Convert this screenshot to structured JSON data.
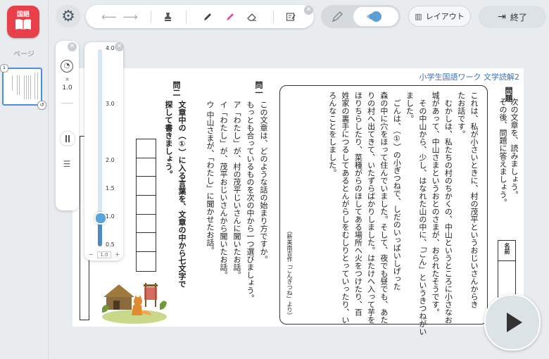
{
  "app": {
    "icon_label": "国語",
    "pages_label": "ページ",
    "thumbnail_number": "1"
  },
  "toolbar": {
    "back_icon": "arrow-left-icon",
    "forward_icon": "arrow-right-icon",
    "tools": [
      "stamp-icon",
      "pen-icon",
      "highlighter-icon",
      "eraser-icon",
      "edit-note-icon"
    ],
    "mode": [
      "pen-mode-icon",
      "touch-mode-icon"
    ],
    "layout_label": "レイアウト",
    "end_label": "終了"
  },
  "side_panel": {
    "speed_prefix": "×",
    "speed_value": "1.0"
  },
  "slider": {
    "ticks": [
      "4.0",
      "3.0",
      "2.0",
      "1.5",
      "1.0",
      "0.5"
    ],
    "value": "1.0",
    "minus": "−",
    "plus": "+"
  },
  "document": {
    "series_title": "小学生国語ワーク 文学読解2",
    "question_heading": "問題",
    "instruction": "次の文章を、読みましょう。\nその後、問題に答えましょう。",
    "name_label": "名前",
    "story": "これは、私が小さいときに、村の茂平というおじいさんからき\nたお話です。\n　むかしは、私たちの村のちかくの、中山というところに小さなお\n城があって、中山さまというおとのさまが、おられたそうです。\n　その中山から、少し、はなれた山の中に、「ごん」というきつねがい\nました。\n　ごんは、（①）の小ぎつねで、しだのいっぱいしげった\n森の中に穴をほって住んでいました。そして、夜でも昼でも、あた\nりの村へ出てきて、いたずらばかりしました。はたけへ入って芋を\nほりちらしたり、菜種がらのほしてある場所へ火をつけたり、百\n姓家の裏手につるしてあるとんがらしをむしりとっていったり、い\nろんなことをしました。",
    "source": "（新美南吉作「ごんぎつね」より）",
    "q1_label": "問一",
    "q1_text": "この文章は、どのような話の始まり方ですか。\nもっとも合っているものを次の中から一つ選びましょう。\nア「わたし」が、村の茂平じいさんに聞いたお話。\nイ「わたし」が、茂平おじいさんから聞いたお話。\nウ 中山さまが、「わたし」に聞かせたお話。",
    "q2_label": "問二",
    "q2_text": "文章中の（①）に入る言葉を、文章の中から七文字で\n探して書きましょう。",
    "answer_cells": 7,
    "illustration": "fox-and-farmhouse-illustration"
  },
  "player": {
    "play_icon": "play-icon"
  }
}
